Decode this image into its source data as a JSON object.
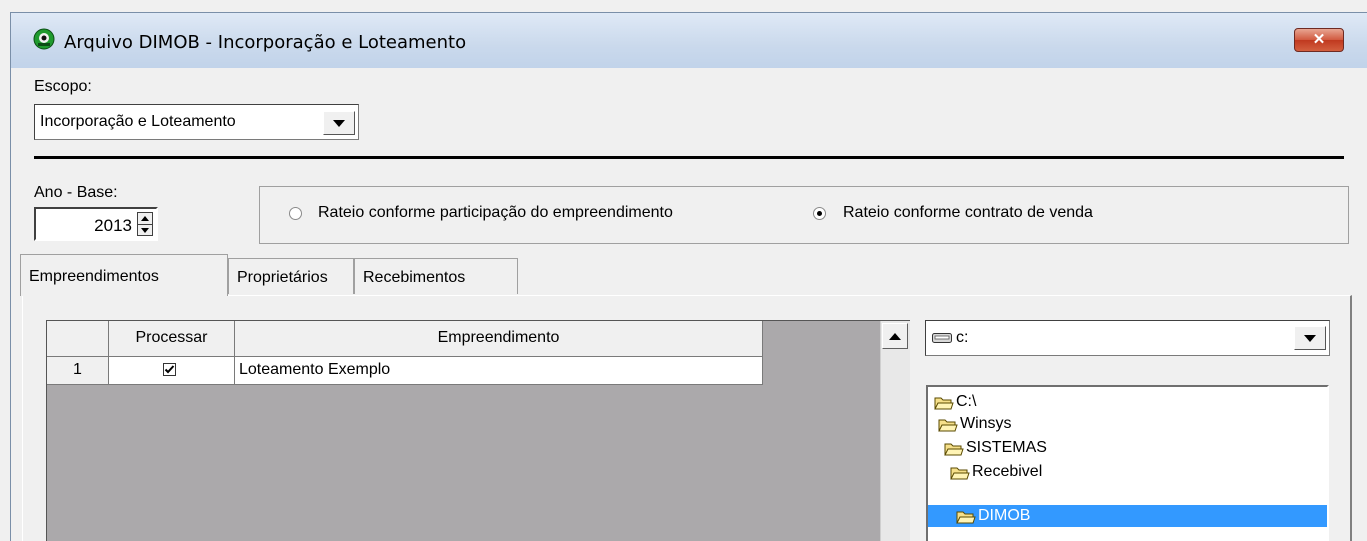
{
  "window": {
    "title": "Arquivo DIMOB - Incorporação e Loteamento",
    "close_label": "✕"
  },
  "escopo": {
    "label": "Escopo:",
    "selected": "Incorporação e Loteamento"
  },
  "ano_base": {
    "label": "Ano - Base:",
    "value": "2013"
  },
  "rateio": {
    "options": [
      {
        "label": "Rateio conforme participação do empreendimento",
        "checked": false
      },
      {
        "label": "Rateio conforme contrato de venda",
        "checked": true
      }
    ]
  },
  "tabs": [
    {
      "label": "Empreendimentos",
      "active": true
    },
    {
      "label": "Proprietários",
      "active": false
    },
    {
      "label": "Recebimentos",
      "active": false
    }
  ],
  "grid": {
    "columns": [
      "",
      "Processar",
      "Empreendimento"
    ],
    "rows": [
      {
        "num": "1",
        "processar": true,
        "empreendimento": "Loteamento Exemplo"
      }
    ]
  },
  "drive": {
    "selected": "c:",
    "icon": "drive-icon"
  },
  "tree": {
    "items": [
      {
        "label": "C:\\",
        "selected": false
      },
      {
        "label": "Winsys",
        "selected": false
      },
      {
        "label": "SISTEMAS",
        "selected": false
      },
      {
        "label": "Recebivel",
        "selected": false
      },
      {
        "label": "DIMOB",
        "selected": true
      }
    ]
  },
  "colors": {
    "selection": "#3399ff",
    "grid_background": "#aba9ab"
  }
}
